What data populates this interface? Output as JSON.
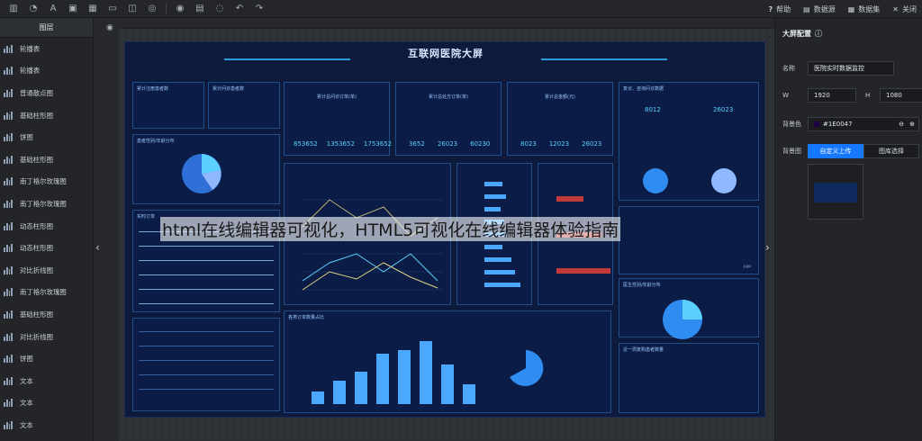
{
  "toolbar": {
    "right": {
      "help": "帮助",
      "data_source": "数据源",
      "dataset": "数据集",
      "close": "关闭"
    },
    "icons": [
      "bar-chart-icon",
      "text-icon",
      "image-icon",
      "table-icon",
      "media-icon",
      "border-icon",
      "component-icon",
      "database-icon",
      "save-icon",
      "preview-icon",
      "undo-icon",
      "redo-icon"
    ]
  },
  "layers": {
    "header": "图层",
    "items": [
      "轮播表",
      "轮播表",
      "普通散点图",
      "基础柱形图",
      "饼图",
      "基础柱形图",
      "南丁格尔玫瑰图",
      "南丁格尔玫瑰图",
      "动态柱形图",
      "动态柱形图",
      "对比折线图",
      "南丁格尔玫瑰图",
      "基础柱形图",
      "对比折线图",
      "饼图",
      "文本",
      "文本",
      "文本"
    ]
  },
  "dashboard": {
    "title": "互联网医院大屏",
    "panels": {
      "p1": "累计注册患者数",
      "p2": "累计问诊患者数",
      "p3": "累计总问诊订单(单)",
      "p4": "累计总处方订单(单)",
      "p5": "累计总金额(元)",
      "gender": "患者性别/年龄分布",
      "orders": "实时订单",
      "bottom_left": "各类订单数量占比",
      "revenue": "各类订单",
      "right_top": "复诊、咨询问诊数据",
      "right_mid": "医生性别/年龄分布",
      "right_bottom": "近一周复购患者数量"
    },
    "stats": {
      "p3": [
        "853652",
        "1353652",
        "1753652"
      ],
      "p4": [
        "3652",
        "26023",
        "60230"
      ],
      "p5": [
        "8023",
        "12023",
        "26023"
      ],
      "right": [
        "8012",
        "26023"
      ]
    },
    "bar_values": [
      "120879",
      "231879",
      "340879",
      "534760",
      "560879",
      "670879",
      "405879",
      "200879"
    ],
    "right_labels": [
      "APP"
    ]
  },
  "watermark": "html在线编辑器可视化，HTML5可视化在线编辑器体验指南",
  "config": {
    "title": "大屏配置",
    "name_label": "名称",
    "name_value": "医院实时数据监控",
    "w_label": "W",
    "w_value": "1920",
    "h_label": "H",
    "h_value": "1080",
    "bg_color_label": "背景色",
    "bg_color_value": "#1E0047",
    "bg_image_label": "背景图",
    "upload_button": "自定义上传",
    "library_button": "图库选择"
  },
  "colors": {
    "accent": "#1677ff",
    "panel_bg": "#232529",
    "dash_bg": "#0e1a3b",
    "cyan": "#5bd0ff"
  }
}
